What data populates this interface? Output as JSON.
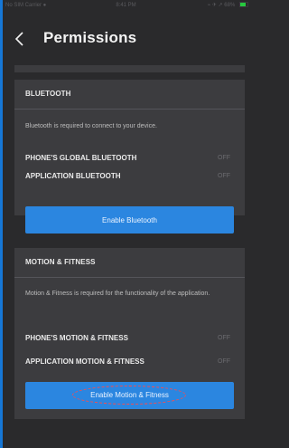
{
  "status_bar": {
    "left": "No SIM  Carrier ●",
    "time": "8:41 PM",
    "right": "⌁ ✈ ↗ 68%"
  },
  "header": {
    "back_icon": "chevron-left-icon",
    "title": "Permissions"
  },
  "bluetooth_section": {
    "title": "BLUETOOTH",
    "description": "Bluetooth is required to connect to your device.",
    "rows": [
      {
        "label": "PHONE'S GLOBAL BLUETOOTH",
        "value": "OFF"
      },
      {
        "label": "APPLICATION BLUETOOTH",
        "value": "OFF"
      }
    ],
    "button_label": "Enable Bluetooth"
  },
  "motion_section": {
    "title": "MOTION & FITNESS",
    "description": "Motion & Fitness is required for the functionality of the application.",
    "rows": [
      {
        "label": "PHONE'S MOTION & FITNESS",
        "value": "OFF"
      },
      {
        "label": "APPLICATION MOTION & FITNESS",
        "value": "OFF"
      }
    ],
    "button_label": "Enable Motion & Fitness"
  },
  "colors": {
    "background": "#2a2a2c",
    "card": "#3c3c3f",
    "accent_button": "#2b86e0",
    "highlight_ellipse": "#ff4a4a",
    "battery": "#27c93f"
  }
}
